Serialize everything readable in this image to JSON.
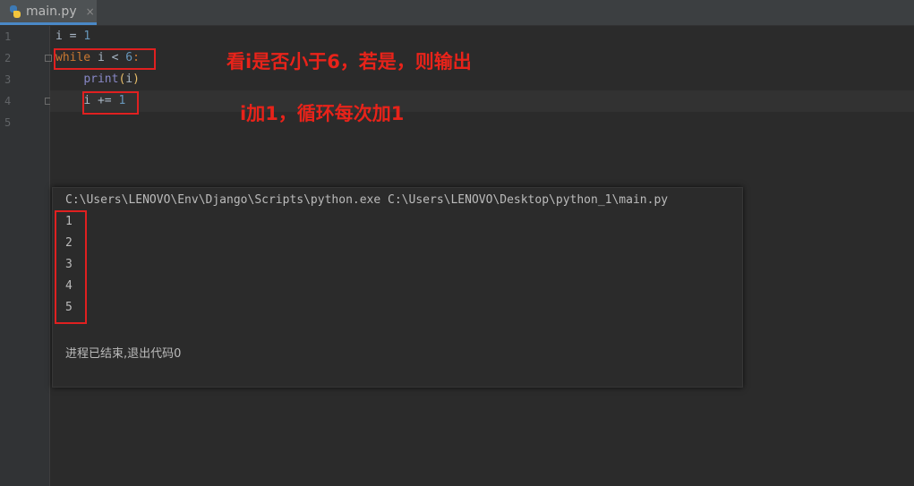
{
  "tab": {
    "filename": "main.py",
    "close_glyph": "×",
    "icon": "python-file-icon"
  },
  "gutter": {
    "line_numbers": [
      "1",
      "2",
      "3",
      "4",
      "5"
    ]
  },
  "code": {
    "line1": {
      "var": "i",
      "op": " = ",
      "num": "1"
    },
    "line2": {
      "kw": "while",
      "mid": " i < ",
      "num": "6",
      "end": ":"
    },
    "line3": {
      "indent": "    ",
      "fn": "print",
      "open": "(",
      "arg": "i",
      "close": ")"
    },
    "line4": {
      "indent": "    ",
      "text": "i += ",
      "num": "1"
    }
  },
  "annotations": {
    "first": "看i是否小于6，若是，则输出",
    "second": "i加1，循环每次加1"
  },
  "console": {
    "command": "C:\\Users\\LENOVO\\Env\\Django\\Scripts\\python.exe C:\\Users\\LENOVO\\Desktop\\python_1\\main.py",
    "outputs": [
      "1",
      "2",
      "3",
      "4",
      "5"
    ],
    "exit_message": "进程已结束,退出代码0"
  },
  "colors": {
    "annotation_red": "#e02020",
    "keyword": "#cc7832",
    "number": "#6897bb",
    "builtin": "#8888c6"
  }
}
